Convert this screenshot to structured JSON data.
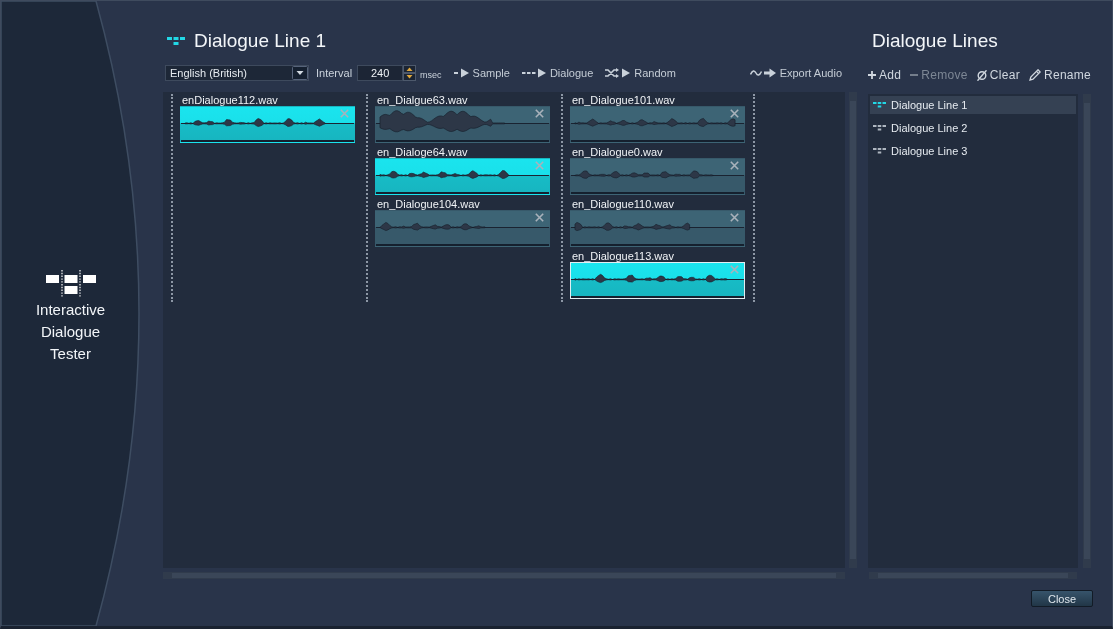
{
  "app_title": "Interactive Dialogue Tester",
  "line_editor": {
    "title": "Dialogue Line 1",
    "language": "English (British)",
    "interval_label": "Interval",
    "interval": "240",
    "interval_unit": "msec",
    "actions": [
      {
        "kind": "sample",
        "label": "Sample"
      },
      {
        "kind": "dialogue",
        "label": "Dialogue"
      },
      {
        "kind": "random",
        "label": "Random"
      },
      {
        "kind": "export",
        "label": "Export Audio"
      }
    ],
    "lanes": [
      {
        "clips": [
          {
            "file": "enDialogue112.wav",
            "selected": true,
            "focused": false
          }
        ]
      },
      {
        "clips": [
          {
            "file": "en_Dialgue63.wav",
            "selected": false,
            "focused": false
          },
          {
            "file": "en_Dialoge64.wav",
            "selected": true,
            "focused": false
          },
          {
            "file": "en_Dialogue104.wav",
            "selected": false,
            "focused": false
          }
        ]
      },
      {
        "clips": [
          {
            "file": "en_Dialogue101.wav",
            "selected": false,
            "focused": false
          },
          {
            "file": "en_Dialogue0.wav",
            "selected": false,
            "focused": false
          },
          {
            "file": "en_Dialogue110.wav",
            "selected": false,
            "focused": false
          },
          {
            "file": "en_Dialogue113.wav",
            "selected": true,
            "focused": true
          }
        ]
      }
    ]
  },
  "dialogue_lines": {
    "title": "Dialogue Lines",
    "actions": [
      {
        "kind": "add",
        "label": "Add",
        "disabled": false
      },
      {
        "kind": "remove",
        "label": "Remove",
        "disabled": true
      },
      {
        "kind": "clear",
        "label": "Clear",
        "disabled": false
      },
      {
        "kind": "rename",
        "label": "Rename",
        "disabled": false
      }
    ],
    "items": [
      {
        "label": "Dialogue Line 1",
        "selected": true
      },
      {
        "label": "Dialogue Line 2",
        "selected": false
      },
      {
        "label": "Dialogue Line 3",
        "selected": false
      }
    ]
  },
  "close_button": "Close"
}
